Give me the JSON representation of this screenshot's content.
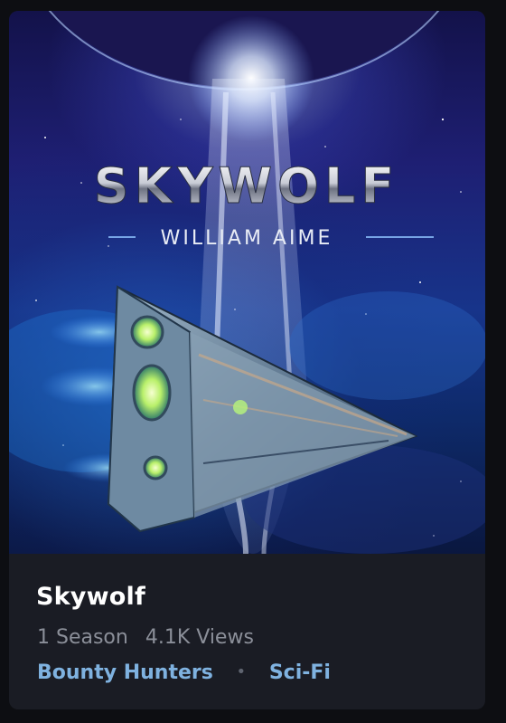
{
  "cover": {
    "title_text": "SKYWOLF",
    "author_text": "WILLIAM AIME"
  },
  "show": {
    "title": "Skywolf",
    "seasons": "1 Season",
    "views": "4.1K Views",
    "genres": [
      "Bounty Hunters",
      "Sci-Fi"
    ],
    "separator": "•"
  },
  "colors": {
    "background": "#0d0e12",
    "card": "#1a1c24",
    "title": "#ffffff",
    "meta": "#8b8f99",
    "genre_link": "#7fb2e0"
  }
}
